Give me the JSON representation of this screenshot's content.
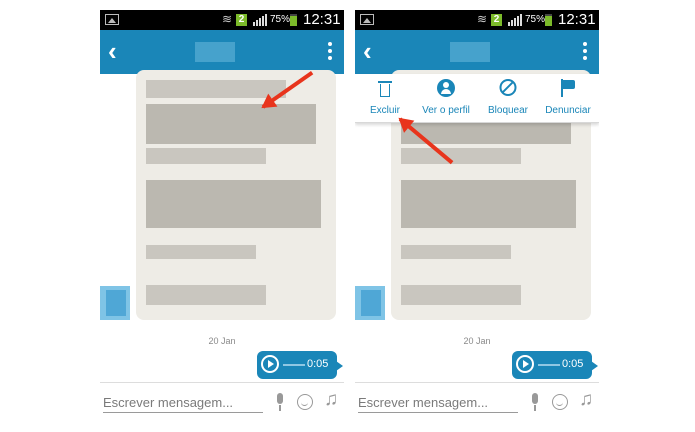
{
  "left_screen": {
    "status_bar": {
      "sim_slot": "2",
      "battery": "75%",
      "time": "12:31"
    },
    "app_bar": {
      "back_glyph": "‹"
    },
    "chat": {
      "date_label": "20 Jan",
      "audio_duration": "0:05"
    },
    "input": {
      "placeholder": "Escrever mensagem..."
    }
  },
  "right_screen": {
    "status_bar": {
      "sim_slot": "2",
      "battery": "75%",
      "time": "12:31"
    },
    "app_bar": {
      "back_glyph": "‹"
    },
    "menu": [
      {
        "label": "Excluir",
        "icon": "trash-icon"
      },
      {
        "label": "Ver o perfil",
        "icon": "profile-icon"
      },
      {
        "label": "Bloquear",
        "icon": "block-icon"
      },
      {
        "label": "Denunciar",
        "icon": "flag-icon"
      }
    ],
    "chat": {
      "date_label": "20 Jan",
      "audio_duration": "0:05"
    },
    "input": {
      "placeholder": "Escrever mensagem..."
    }
  },
  "colors": {
    "accent": "#1a86b8",
    "annotation_arrow": "#e8341c",
    "status_bar": "#000000",
    "bubble": "#eeece6"
  }
}
